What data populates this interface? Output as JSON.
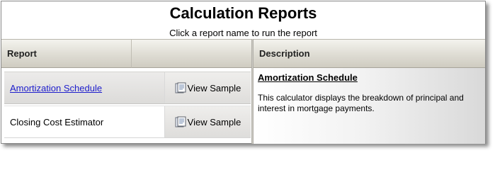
{
  "header": {
    "title": "Calculation Reports",
    "subtitle": "Click a report name to run the report"
  },
  "table": {
    "columns": [
      "Report",
      "",
      "Description"
    ],
    "rows": [
      {
        "name": "Amortization Schedule",
        "sample_label": "View Sample",
        "selected": true
      },
      {
        "name": "Closing Cost Estimator",
        "sample_label": "View Sample",
        "selected": false
      }
    ]
  },
  "description": {
    "title": "Amortization Schedule",
    "text": "This calculator displays the breakdown of principal and interest in mortgage payments."
  },
  "icons": {
    "sample": "document-preview-icon"
  },
  "colors": {
    "link": "#1d1dcc",
    "header_bg": "#dedcd3"
  }
}
